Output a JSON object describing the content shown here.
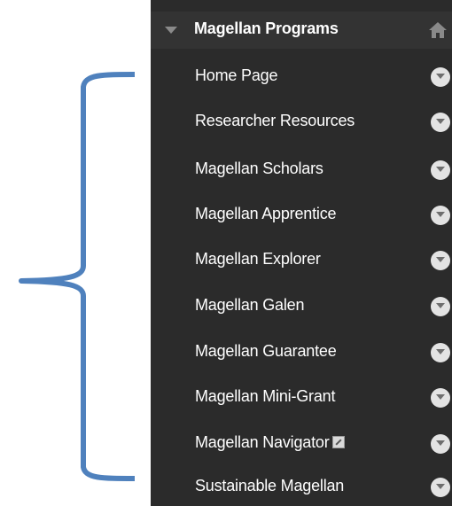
{
  "menu": {
    "title": "Magellan Programs",
    "items": [
      {
        "label": "Home Page"
      },
      {
        "label": "Researcher Resources"
      },
      {
        "label": "Magellan Scholars"
      },
      {
        "label": "Magellan Apprentice"
      },
      {
        "label": "Magellan Explorer"
      },
      {
        "label": "Magellan Galen"
      },
      {
        "label": "Magellan Guarantee"
      },
      {
        "label": "Magellan Mini-Grant"
      },
      {
        "label": "Magellan Navigator"
      },
      {
        "label": "Sustainable Magellan"
      }
    ]
  },
  "icons": {
    "toggle": "chevron-down-icon",
    "home": "home-icon",
    "item_menu": "options-dropdown-icon",
    "external": "external-link-icon"
  },
  "colors": {
    "menu_background": "#2b2b2b",
    "header_background": "#333333",
    "text": "#ffffff",
    "brace": "#4f81bd"
  }
}
